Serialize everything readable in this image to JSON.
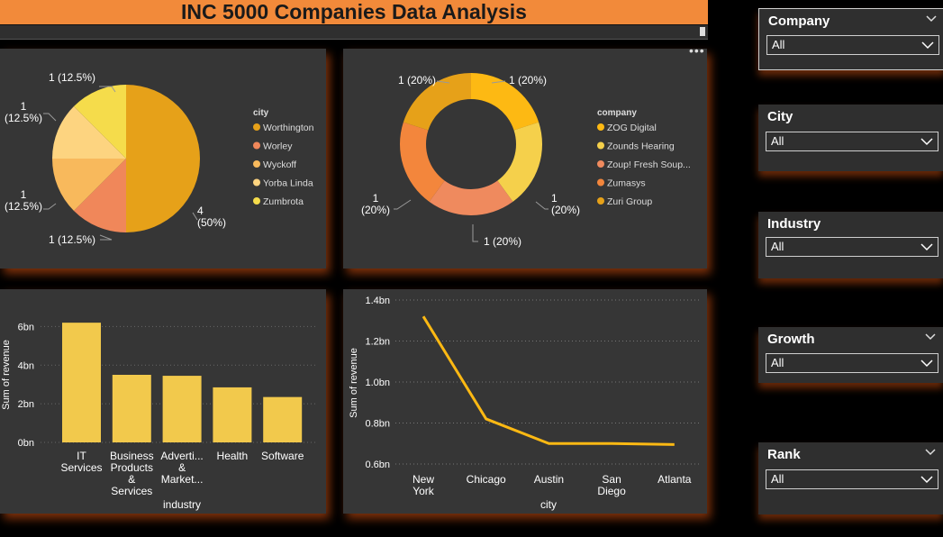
{
  "header": {
    "title": "INC 5000 Companies Data Analysis"
  },
  "colors": {
    "title_bg": "#f28a3a",
    "panel_bg": "#363636",
    "accent": "#fdb913",
    "bar": "#f2c94c"
  },
  "chart_data": [
    {
      "type": "pie",
      "legend_title": "city",
      "legend_position": "right",
      "slices": [
        {
          "label": "Worthington",
          "value": 4,
          "data_label": "4 (50%)",
          "color": "#e6a119"
        },
        {
          "label": "Worley",
          "value": 1,
          "data_label": "1 (12.5%)",
          "color": "#f0875a"
        },
        {
          "label": "Wyckoff",
          "value": 1,
          "data_label": "1 (12.5%)",
          "color": "#f8b95c"
        },
        {
          "label": "Yorba Linda",
          "value": 1,
          "data_label": "1 (12.5%)",
          "color": "#fdd480"
        },
        {
          "label": "Zumbrota",
          "value": 1,
          "data_label": "1 (12.5%)",
          "color": "#f5dc4b"
        }
      ]
    },
    {
      "type": "pie",
      "subtype": "donut",
      "legend_title": "company",
      "legend_position": "right",
      "slices": [
        {
          "label": "ZOG Digital",
          "value": 1,
          "data_label": "1 (20%)",
          "color": "#fdb913"
        },
        {
          "label": "Zounds Hearing",
          "value": 1,
          "data_label": "1 (20%)",
          "color": "#f5d04b"
        },
        {
          "label": "Zoup! Fresh Soup...",
          "value": 1,
          "data_label": "1 (20%)",
          "color": "#ef8a5e"
        },
        {
          "label": "Zumasys",
          "value": 1,
          "data_label": "1 (20%)",
          "color": "#f3863c"
        },
        {
          "label": "Zuri Group",
          "value": 1,
          "data_label": "1 (20%)",
          "color": "#e6a119"
        }
      ]
    },
    {
      "type": "bar",
      "categories": [
        "IT Services",
        "Business Products & Services",
        "Adverti... & Market...",
        "Health",
        "Software"
      ],
      "values": [
        6.2,
        3.5,
        3.45,
        2.85,
        2.35
      ],
      "xlabel": "industry",
      "ylabel": "Sum of revenue",
      "yticks": [
        "0bn",
        "2bn",
        "4bn",
        "6bn"
      ],
      "ylim": [
        0,
        7
      ],
      "grid": true
    },
    {
      "type": "line",
      "categories": [
        "New York",
        "Chicago",
        "Austin",
        "San Diego",
        "Atlanta"
      ],
      "values": [
        1.32,
        0.82,
        0.7,
        0.7,
        0.695
      ],
      "xlabel": "city",
      "ylabel": "Sum of revenue",
      "yticks": [
        "0.6bn",
        "0.8bn",
        "1.0bn",
        "1.2bn",
        "1.4bn"
      ],
      "ylim": [
        0.6,
        1.4
      ],
      "grid": true
    }
  ],
  "slicers": [
    {
      "title": "Company",
      "value": "All"
    },
    {
      "title": "City",
      "value": "All"
    },
    {
      "title": "Industry",
      "value": "All"
    },
    {
      "title": "Growth",
      "value": "All"
    },
    {
      "title": "Rank",
      "value": "All"
    }
  ]
}
